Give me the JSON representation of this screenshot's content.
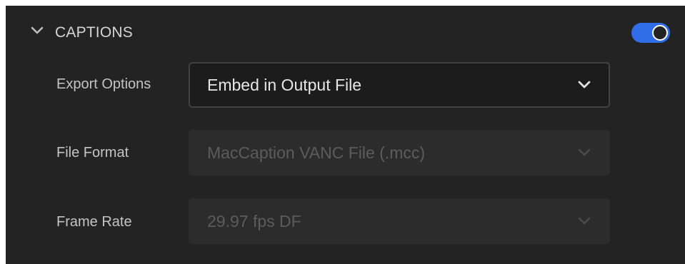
{
  "section": {
    "title": "CAPTIONS",
    "enabled": true
  },
  "rows": {
    "export_options": {
      "label": "Export Options",
      "value": "Embed in Output File",
      "enabled": true
    },
    "file_format": {
      "label": "File Format",
      "value": "MacCaption VANC File (.mcc)",
      "enabled": false
    },
    "frame_rate": {
      "label": "Frame Rate",
      "value": "29.97 fps DF",
      "enabled": false
    }
  },
  "colors": {
    "panel_background": "#232323",
    "toggle_on": "#2f6ee8",
    "text_primary": "#e6e6e6",
    "text_label": "#c4c4c4",
    "text_disabled": "#5c5c5c"
  },
  "icons": {
    "collapse": "chevron-down-icon",
    "dropdown": "chevron-down-icon"
  }
}
